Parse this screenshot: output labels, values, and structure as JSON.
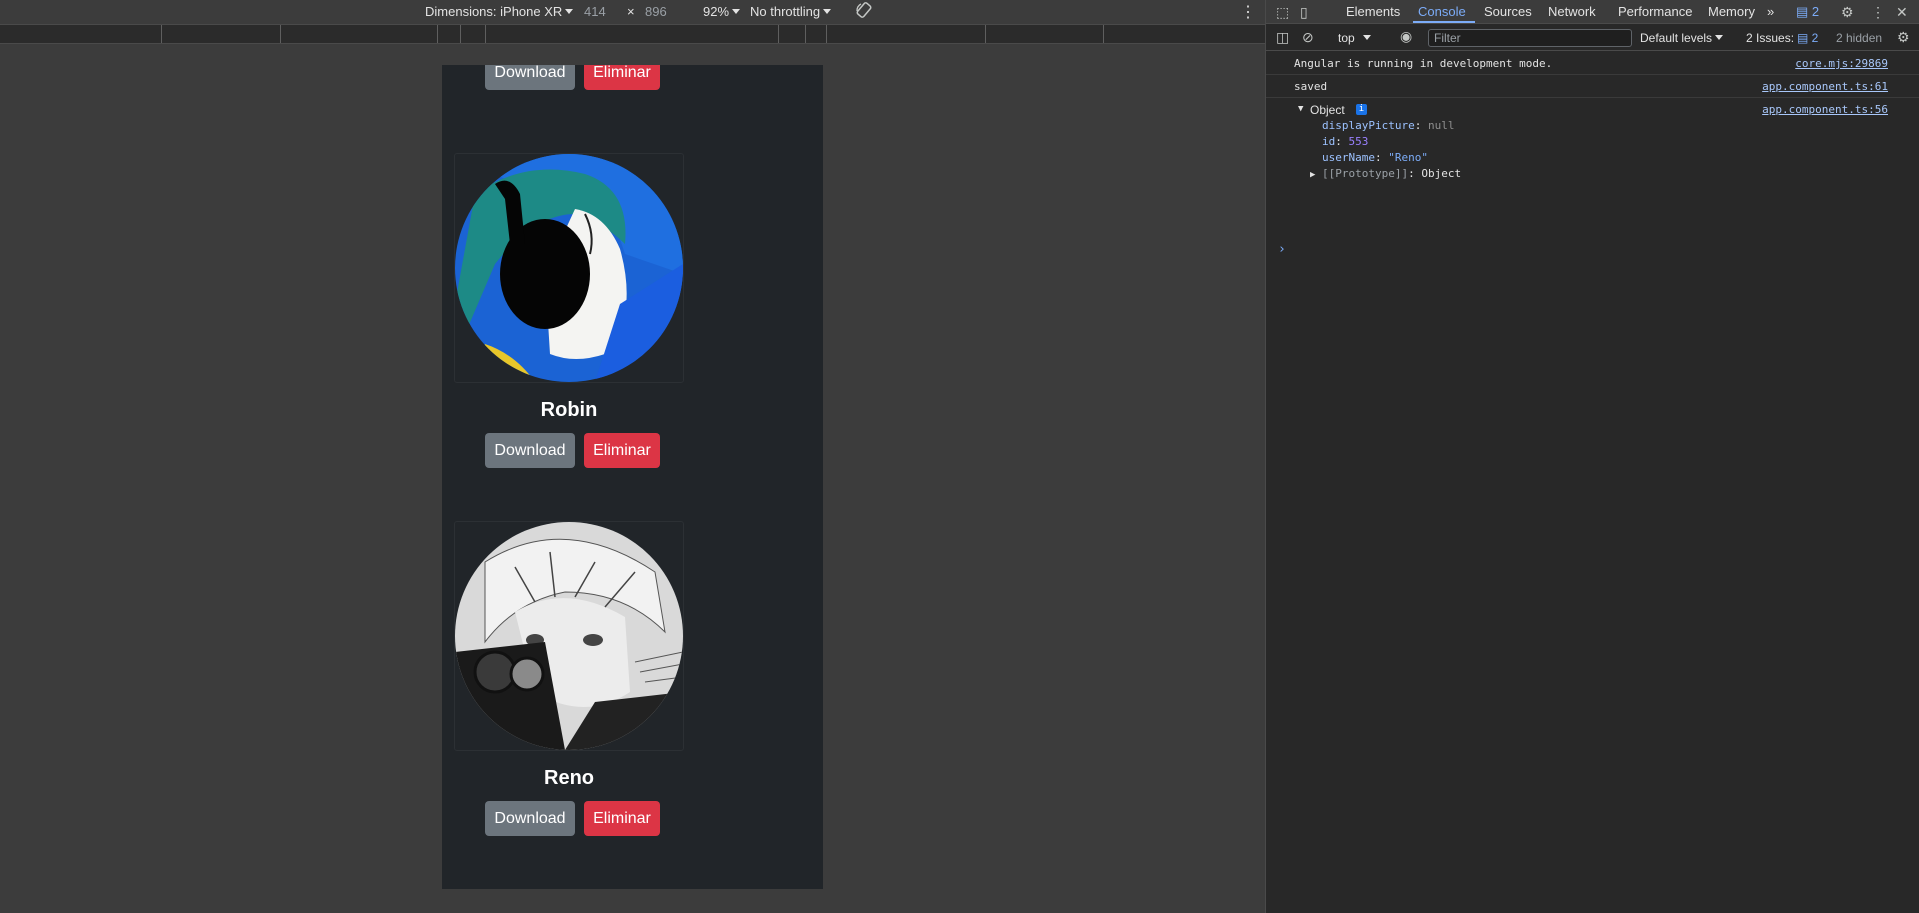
{
  "emulation_toolbar": {
    "dimensions_label": "Dimensions: iPhone XR",
    "width": "414",
    "times": "×",
    "height": "896",
    "zoom": "92%",
    "throttling": "No throttling"
  },
  "users": [
    {
      "name": "",
      "download_label": "Download",
      "delete_label": "Eliminar"
    },
    {
      "name": "Robin",
      "download_label": "Download",
      "delete_label": "Eliminar"
    },
    {
      "name": "Reno",
      "download_label": "Download",
      "delete_label": "Eliminar"
    }
  ],
  "devtools": {
    "tabs": [
      "Elements",
      "Console",
      "Sources",
      "Network",
      "Performance",
      "Memory"
    ],
    "active_tab": "Console",
    "more_tabs_icon": "»",
    "messages_badge": "2",
    "context": "top",
    "filter_placeholder": "Filter",
    "levels": "Default levels",
    "issues_label": "2 Issues:",
    "issues_count": "2",
    "hidden_label": "2 hidden",
    "console": {
      "messages": [
        {
          "text": "Angular is running in development mode.",
          "source": "core.mjs:29869"
        },
        {
          "text": "saved",
          "source": "app.component.ts:61"
        }
      ],
      "object": {
        "label": "Object",
        "source": "app.component.ts:56",
        "info_icon": "i",
        "props": [
          {
            "key": "displayPicture",
            "value": "null"
          },
          {
            "key": "id",
            "value": "553"
          },
          {
            "key": "userName",
            "value": "\"Reno\""
          }
        ],
        "prototype_key": "[[Prototype]]",
        "prototype_value": "Object"
      },
      "prompt": "›"
    }
  }
}
